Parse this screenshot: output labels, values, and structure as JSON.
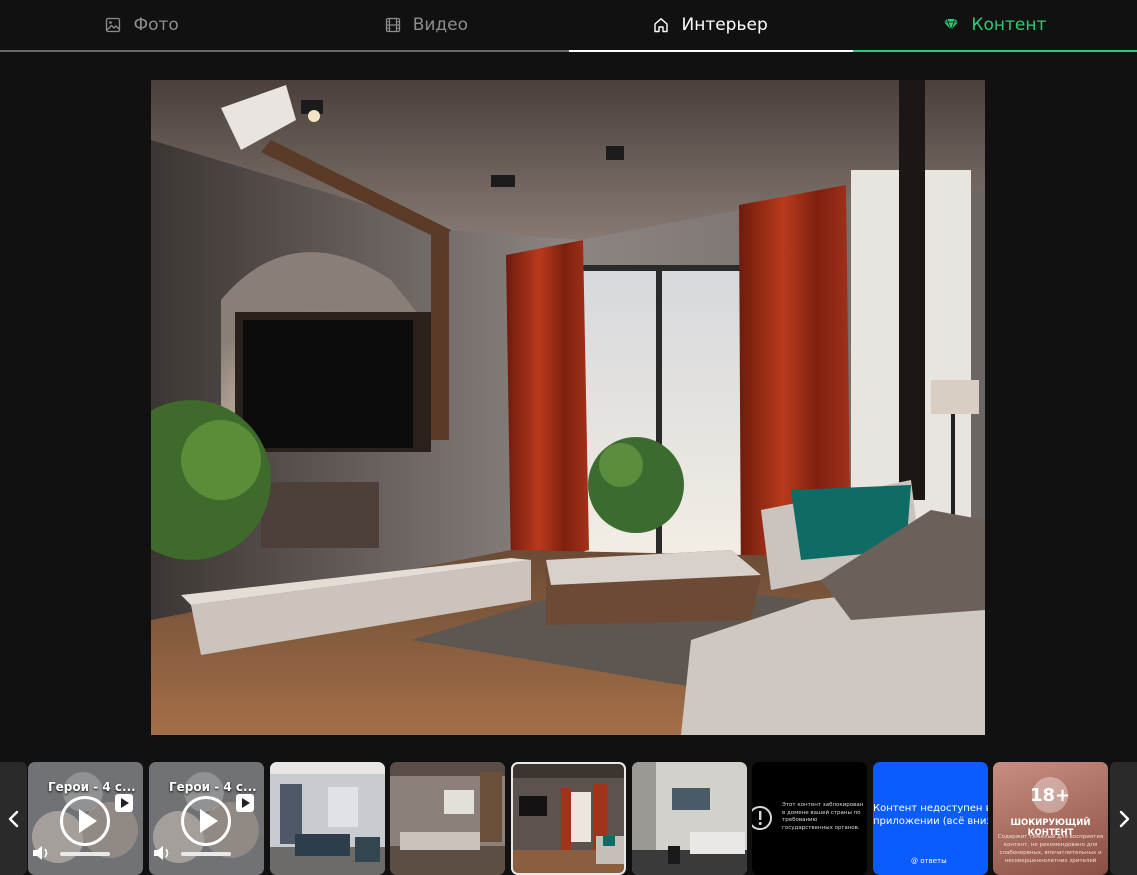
{
  "tabs": [
    {
      "label": "Фото",
      "icon": "image-icon",
      "state": "inactive"
    },
    {
      "label": "Видео",
      "icon": "film-icon",
      "state": "inactive"
    },
    {
      "label": "Интерьер",
      "icon": "home-icon",
      "state": "active"
    },
    {
      "label": "Контент",
      "icon": "gem-icon",
      "state": "accent"
    }
  ],
  "colors": {
    "accent": "#2ecc71",
    "background": "#111111",
    "inactive_text": "#8d8d8d"
  },
  "viewer": {
    "image": "living-room-interior"
  },
  "strip": {
    "prev_icon": "chevron-left-icon",
    "next_icon": "chevron-right-icon",
    "thumbs": [
      {
        "type": "video",
        "title": "Герои - 4 с..."
      },
      {
        "type": "video",
        "title": "Герои - 4 с..."
      },
      {
        "type": "image",
        "image": "interior-1"
      },
      {
        "type": "image",
        "image": "interior-2"
      },
      {
        "type": "image",
        "image": "interior-3",
        "selected": true
      },
      {
        "type": "image",
        "image": "interior-4"
      },
      {
        "type": "blocked",
        "text": "Этот контент заблокирован в домене вашей страны по требованию государственных органов."
      },
      {
        "type": "unavailable",
        "text_line1": "Контент недоступен в этом",
        "text_line2": "приложении (всё внизу)",
        "footer": "@ ответы"
      },
      {
        "type": "adult",
        "badge": "18+",
        "title": "ШОКИРУЮЩИЙ КОНТЕНТ",
        "subtitle": "Содержит тяжелый для восприятия контент, не рекомендовано для слабонервных, впечатлительных и несовершеннолетних зрителей"
      }
    ]
  }
}
